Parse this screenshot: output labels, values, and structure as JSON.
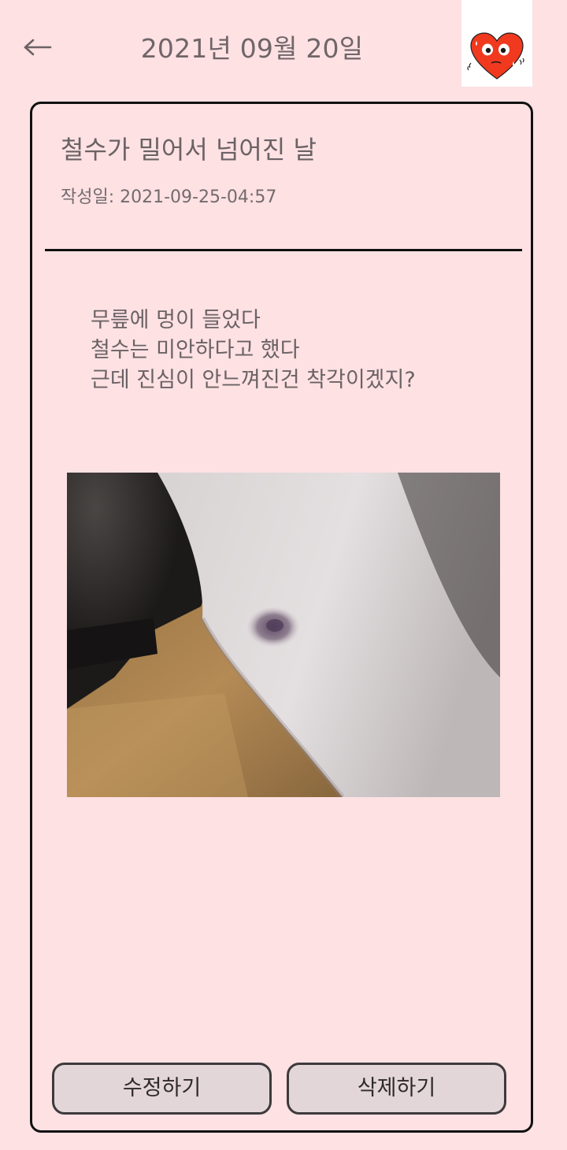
{
  "header": {
    "back_icon": "arrow-left-icon",
    "date": "2021년 09월 20일",
    "mood_icon": "sad-heart-icon",
    "mood_color": "#f0391e"
  },
  "entry": {
    "title": "철수가 밀어서 넘어진 날",
    "created_at": "작성일: 2021-09-25-04:57",
    "body_lines": [
      "무릎에 멍이 들었다",
      "철수는 미안하다고 했다",
      "근데 진심이 안느껴진건 착각이겠지?"
    ]
  },
  "actions": {
    "edit_label": "수정하기",
    "delete_label": "삭제하기"
  },
  "colors": {
    "background": "#fde1e3",
    "card_border": "#111111",
    "text": "#6b6265",
    "button_fill": "#e3d6d9"
  }
}
